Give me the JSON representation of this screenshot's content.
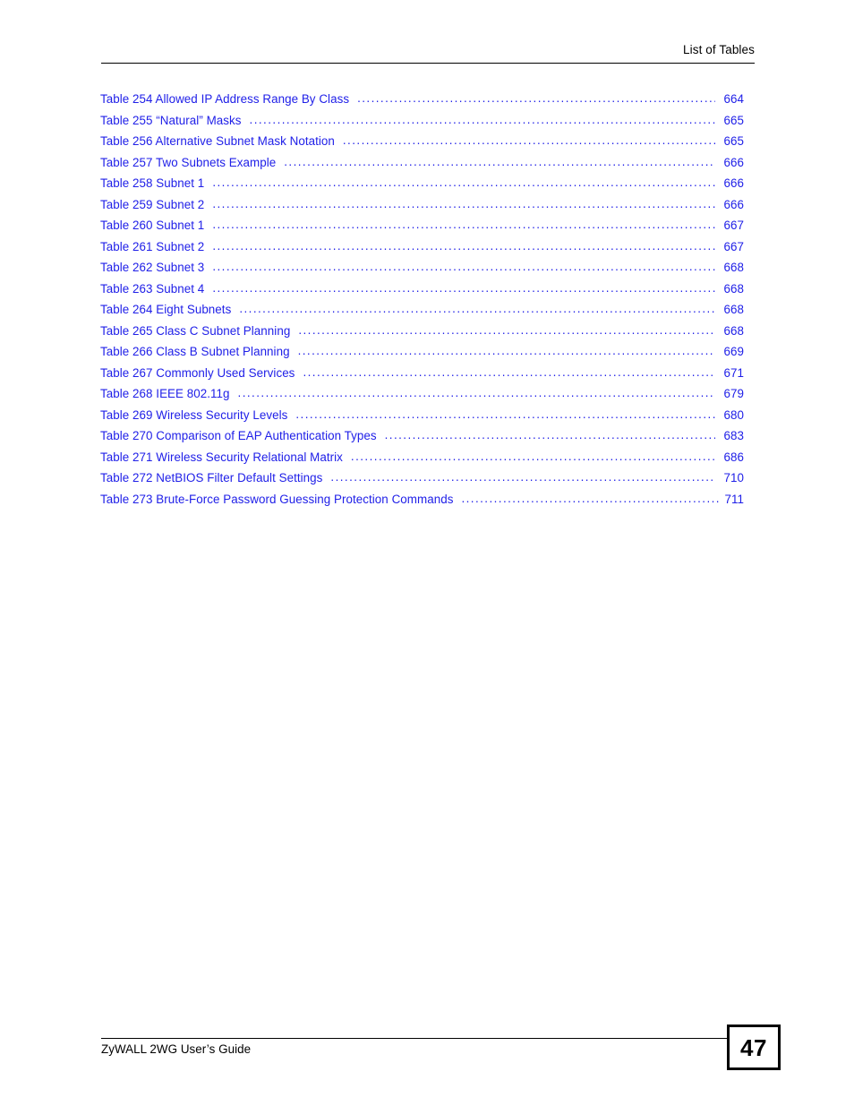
{
  "header": {
    "title": "List of Tables"
  },
  "toc": {
    "entries": [
      {
        "title": "Table 254 Allowed IP Address Range By Class",
        "page": "664"
      },
      {
        "title": "Table 255  “Natural” Masks",
        "page": "665"
      },
      {
        "title": "Table 256 Alternative Subnet Mask Notation",
        "page": "665"
      },
      {
        "title": "Table 257 Two Subnets Example",
        "page": "666"
      },
      {
        "title": "Table 258 Subnet 1",
        "page": "666"
      },
      {
        "title": "Table 259 Subnet 2",
        "page": "666"
      },
      {
        "title": "Table 260 Subnet 1",
        "page": "667"
      },
      {
        "title": "Table 261 Subnet 2",
        "page": "667"
      },
      {
        "title": "Table 262 Subnet 3",
        "page": "668"
      },
      {
        "title": "Table 263 Subnet 4",
        "page": "668"
      },
      {
        "title": "Table 264 Eight Subnets",
        "page": "668"
      },
      {
        "title": "Table 265 Class C Subnet Planning",
        "page": "668"
      },
      {
        "title": "Table 266 Class B Subnet Planning",
        "page": "669"
      },
      {
        "title": "Table 267 Commonly Used Services",
        "page": "671"
      },
      {
        "title": "Table 268 IEEE 802.11g",
        "page": "679"
      },
      {
        "title": "Table 269 Wireless Security Levels",
        "page": "680"
      },
      {
        "title": "Table 270 Comparison of EAP Authentication Types",
        "page": "683"
      },
      {
        "title": "Table 271 Wireless Security Relational Matrix",
        "page": "686"
      },
      {
        "title": "Table 272 NetBIOS Filter Default Settings",
        "page": "710"
      },
      {
        "title": "Table 273 Brute-Force Password Guessing Protection Commands",
        "page": "711",
        "tight": true
      }
    ]
  },
  "footer": {
    "document_title": "ZyWALL 2WG User’s Guide",
    "page_number": "47"
  },
  "colors": {
    "link_blue": "#2020e8",
    "text_black": "#000000",
    "page_background": "#ffffff"
  }
}
